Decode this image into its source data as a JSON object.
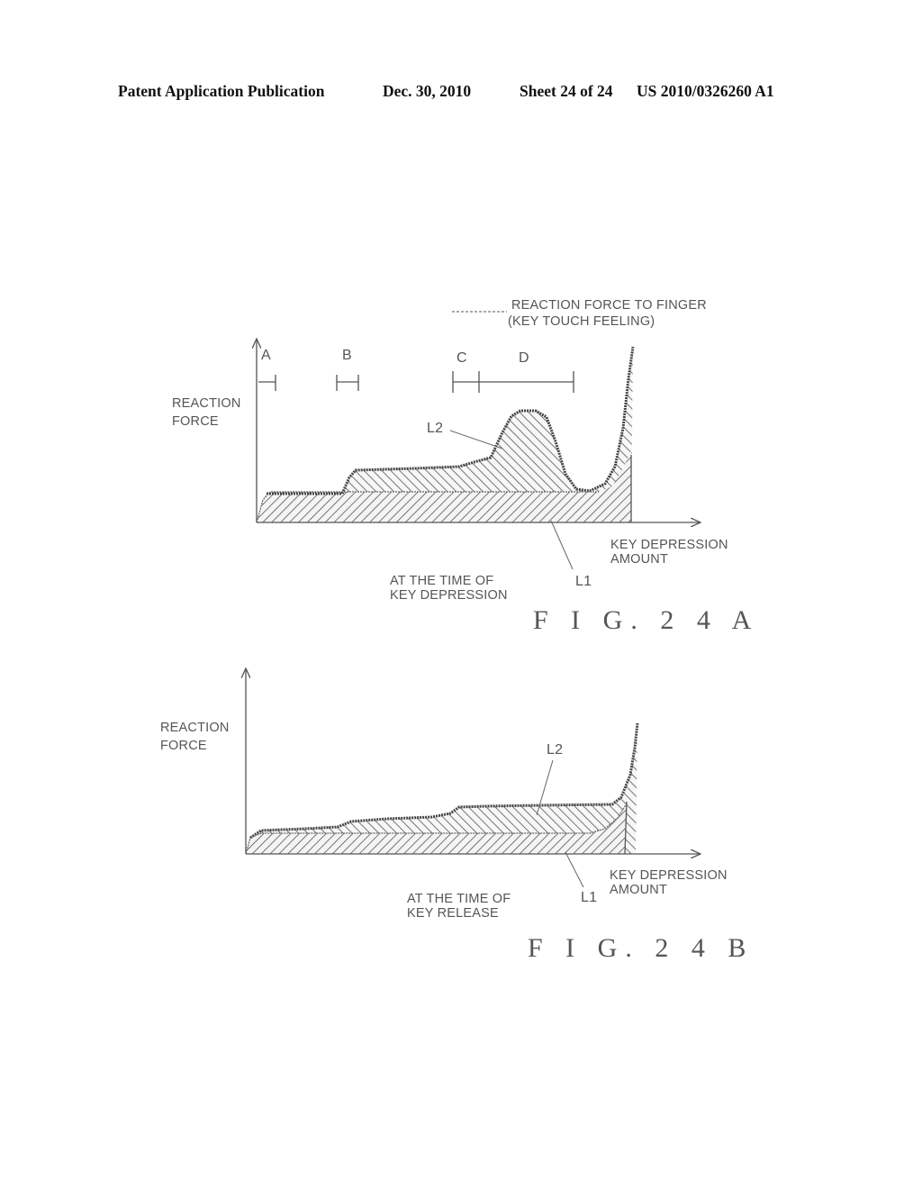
{
  "header": {
    "publication": "Patent Application Publication",
    "date": "Dec. 30, 2010",
    "sheet": "Sheet 24 of 24",
    "number": "US 2010/0326260 A1"
  },
  "figures": [
    {
      "id": "fig-24a",
      "caption": "F I G. 2 4 A",
      "legend_line1": "REACTION FORCE TO FINGER",
      "legend_line2": "(KEY TOUCH FEELING)",
      "y_axis_label_1": "REACTION",
      "y_axis_label_2": "FORCE",
      "x_axis_label_1": "KEY DEPRESSION",
      "x_axis_label_2": "AMOUNT",
      "condition_1": "AT THE TIME OF",
      "condition_2": "KEY DEPRESSION",
      "curve_labels": {
        "l1": "L1",
        "l2": "L2"
      },
      "regions": [
        "A",
        "B",
        "C",
        "D"
      ]
    },
    {
      "id": "fig-24b",
      "caption": "F I G. 2 4 B",
      "y_axis_label_1": "REACTION",
      "y_axis_label_2": "FORCE",
      "x_axis_label_1": "KEY DEPRESSION",
      "x_axis_label_2": "AMOUNT",
      "condition_1": "AT THE TIME OF",
      "condition_2": "KEY RELEASE",
      "curve_labels": {
        "l1": "L1",
        "l2": "L2"
      }
    }
  ]
}
